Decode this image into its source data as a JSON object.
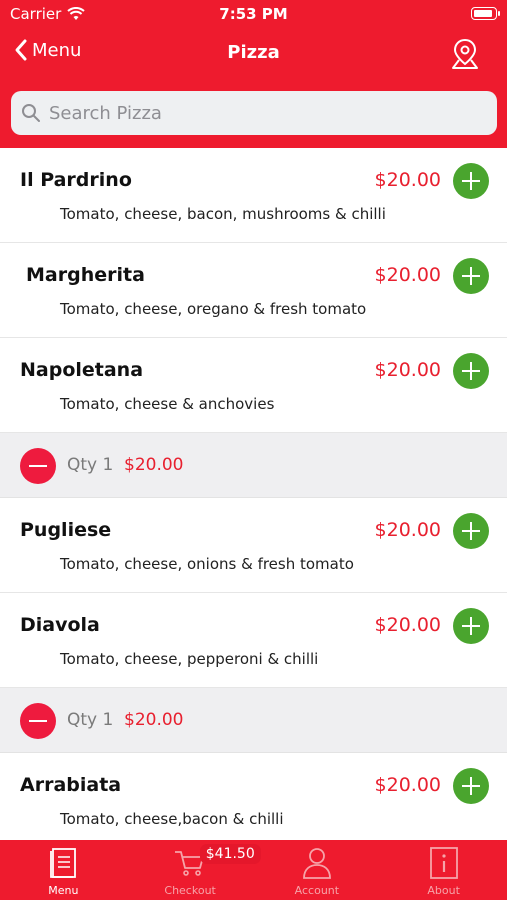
{
  "status_bar": {
    "carrier": "Carrier",
    "time": "7:53 PM"
  },
  "nav": {
    "back_label": "Menu",
    "title": "Pizza"
  },
  "search": {
    "placeholder": "Search Pizza",
    "value": ""
  },
  "items": [
    {
      "name": "Il Pardrino",
      "price": "$20.00",
      "description": "Tomato, cheese, bacon, mushrooms & chilli"
    },
    {
      "name": "Margherita",
      "price": "$20.00",
      "description": "Tomato, cheese, oregano & fresh tomato"
    },
    {
      "name": "Napoletana",
      "price": "$20.00",
      "description": "Tomato, cheese & anchovies"
    },
    {
      "name": "Pugliese",
      "price": "$20.00",
      "description": "Tomato, cheese, onions & fresh tomato"
    },
    {
      "name": "Diavola",
      "price": "$20.00",
      "description": "Tomato, cheese, pepperoni & chilli"
    },
    {
      "name": "Arrabiata",
      "price": "$20.00",
      "description": "Tomato, cheese,bacon & chilli"
    }
  ],
  "qty_rows": [
    {
      "qty_label": "Qty 1",
      "price": "$20.00"
    },
    {
      "qty_label": "Qty 1",
      "price": "$20.00"
    }
  ],
  "tabs": [
    {
      "label": "Menu",
      "icon": "menu-book-icon",
      "active": true
    },
    {
      "label": "Checkout",
      "icon": "cart-icon",
      "badge": "$41.50"
    },
    {
      "label": "Account",
      "icon": "person-icon"
    },
    {
      "label": "About",
      "icon": "info-icon"
    }
  ],
  "colors": {
    "brand_red": "#ee1b2e",
    "add_green": "#4aa52e",
    "price_red": "#e8202f"
  }
}
